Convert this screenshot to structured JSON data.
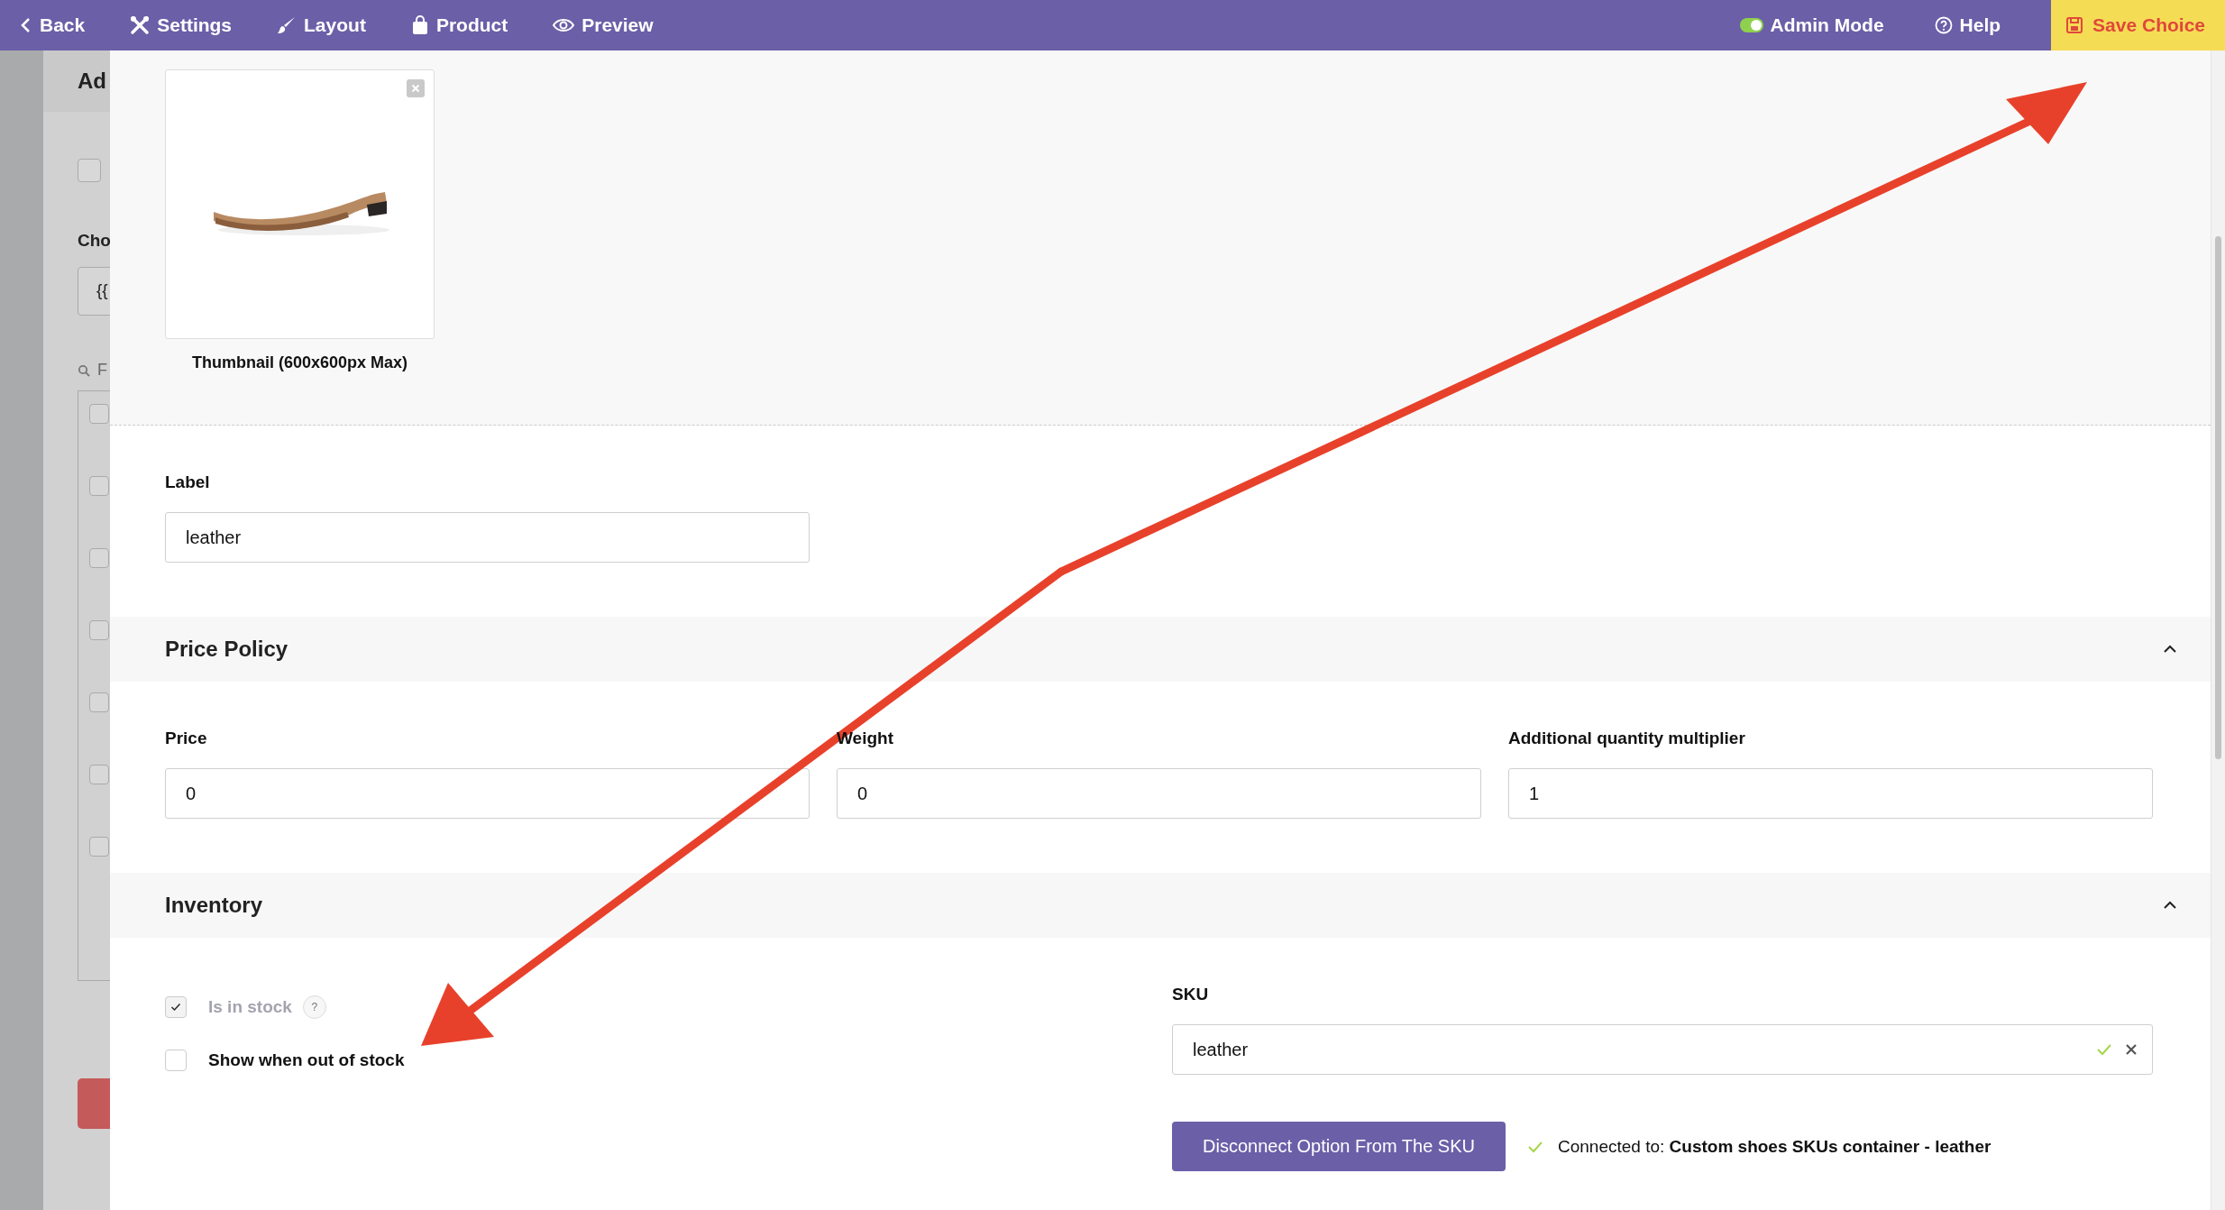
{
  "toolbar": {
    "left": [
      {
        "kind": "back",
        "label": "Back"
      },
      {
        "kind": "settings",
        "label": "Settings"
      },
      {
        "kind": "layout",
        "label": "Layout"
      },
      {
        "kind": "product",
        "label": "Product"
      },
      {
        "kind": "preview",
        "label": "Preview"
      }
    ],
    "admin_mode": {
      "label": "Admin Mode",
      "on": true
    },
    "help": "Help",
    "save": "Save Choice"
  },
  "background_page": {
    "title": "Ad",
    "option_checked": false,
    "field_label": "Cho",
    "field_value": "{{",
    "search_text": "F",
    "rows": [
      {
        "checked": false
      },
      {
        "checked": false
      },
      {
        "checked": false
      },
      {
        "checked": false
      },
      {
        "checked": false
      },
      {
        "checked": false
      },
      {
        "checked": false
      }
    ]
  },
  "thumbnail": {
    "kind": "picture",
    "caption": "Thumbnail (600x600px Max)"
  },
  "label_field": {
    "label": "Label",
    "value": "leather"
  },
  "price_policy": {
    "title": "Price Policy",
    "expanded": true,
    "fields": [
      {
        "label": "Price",
        "value": "0"
      },
      {
        "label": "Weight",
        "value": "0"
      },
      {
        "label": "Additional quantity multiplier",
        "value": "1"
      }
    ]
  },
  "inventory": {
    "title": "Inventory",
    "expanded": true,
    "checkboxes": [
      {
        "label": "Is in stock",
        "checked": true,
        "disabled": true,
        "help": "?"
      },
      {
        "label": "Show when out of stock",
        "checked": false,
        "disabled": false
      }
    ],
    "sku": {
      "label": "SKU",
      "value": "leather",
      "valid": true
    },
    "disconnect_button": "Disconnect Option From The SKU",
    "connection": {
      "connected": true,
      "text": "Connected to: **Custom shoes SKUs container - leather**"
    }
  }
}
